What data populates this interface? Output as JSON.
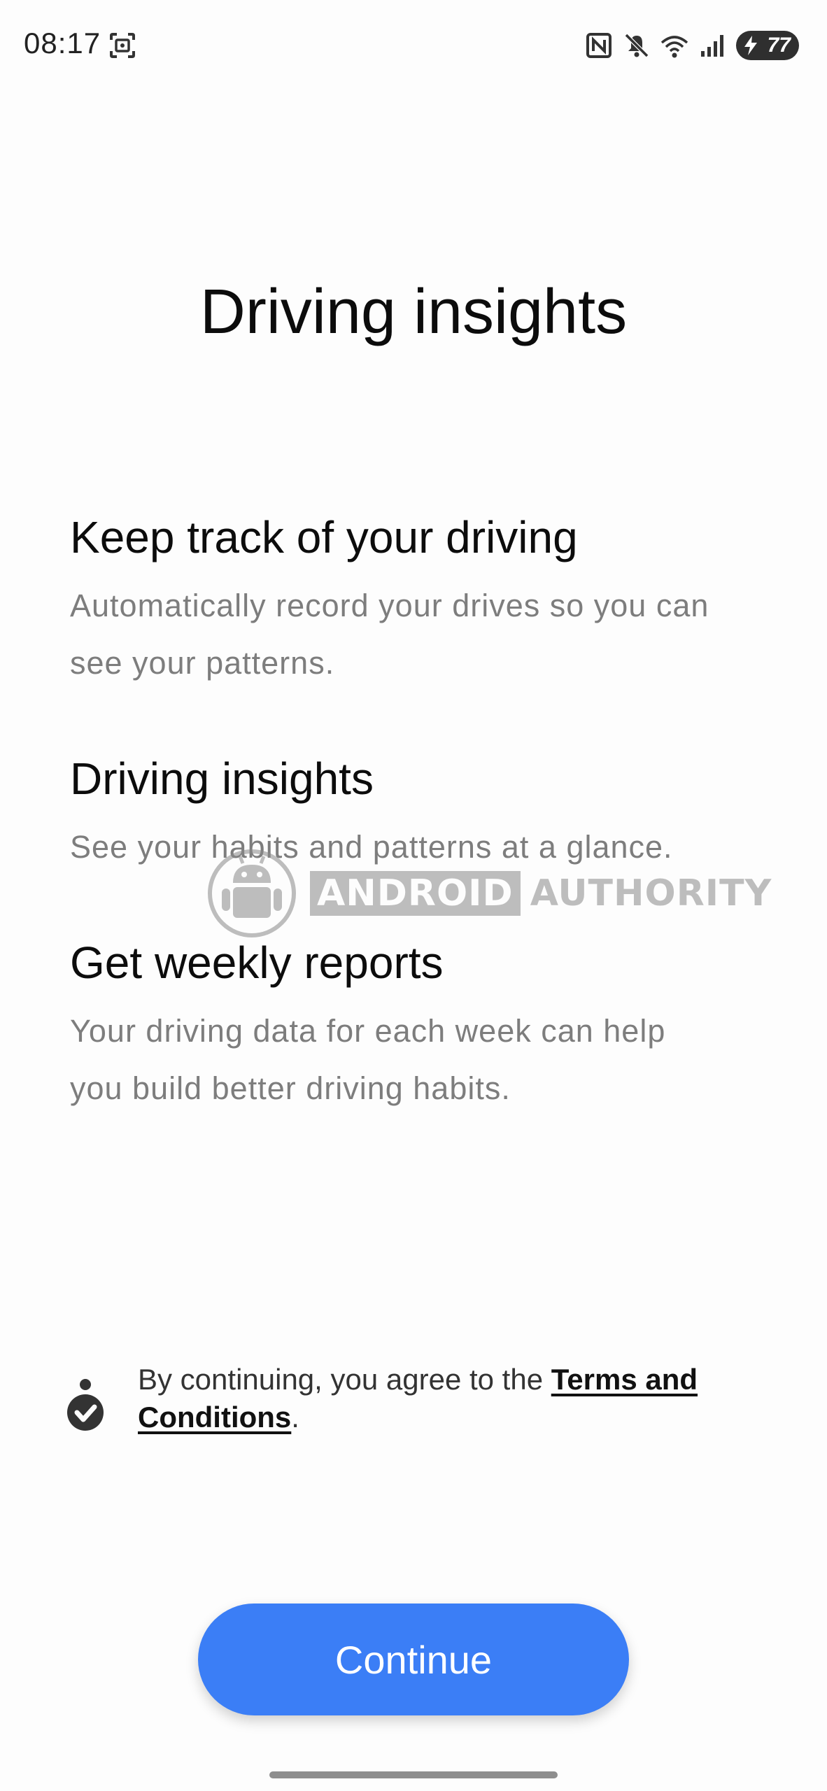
{
  "status_bar": {
    "time": "08:17",
    "battery_level": "77",
    "icons": [
      "screenshot-icon",
      "nfc-icon",
      "mute-icon",
      "wifi-icon",
      "signal-icon",
      "battery-charging-icon"
    ]
  },
  "page": {
    "title": "Driving insights"
  },
  "features": [
    {
      "heading": "Keep track of your driving",
      "line1": "Automatically record your drives so you can",
      "line2": "see your patterns."
    },
    {
      "heading": "Driving insights",
      "line1": "See your habits and patterns at a glance."
    },
    {
      "heading": "Get weekly reports",
      "line1": "Your driving data for each week can help",
      "line2": "you build better driving habits."
    }
  ],
  "terms": {
    "prefix": "By continuing, you agree to the ",
    "link_part1": "Terms and",
    "link_part2": "Conditions",
    "suffix": "."
  },
  "actions": {
    "continue_label": "Continue"
  },
  "watermark": {
    "word1": "ANDROID",
    "word2": "AUTHORITY"
  },
  "colors": {
    "accent": "#3b7ef6",
    "body_text": "#7d7d7d",
    "heading_text": "#0c0c0c",
    "background": "#fdfdfd"
  }
}
